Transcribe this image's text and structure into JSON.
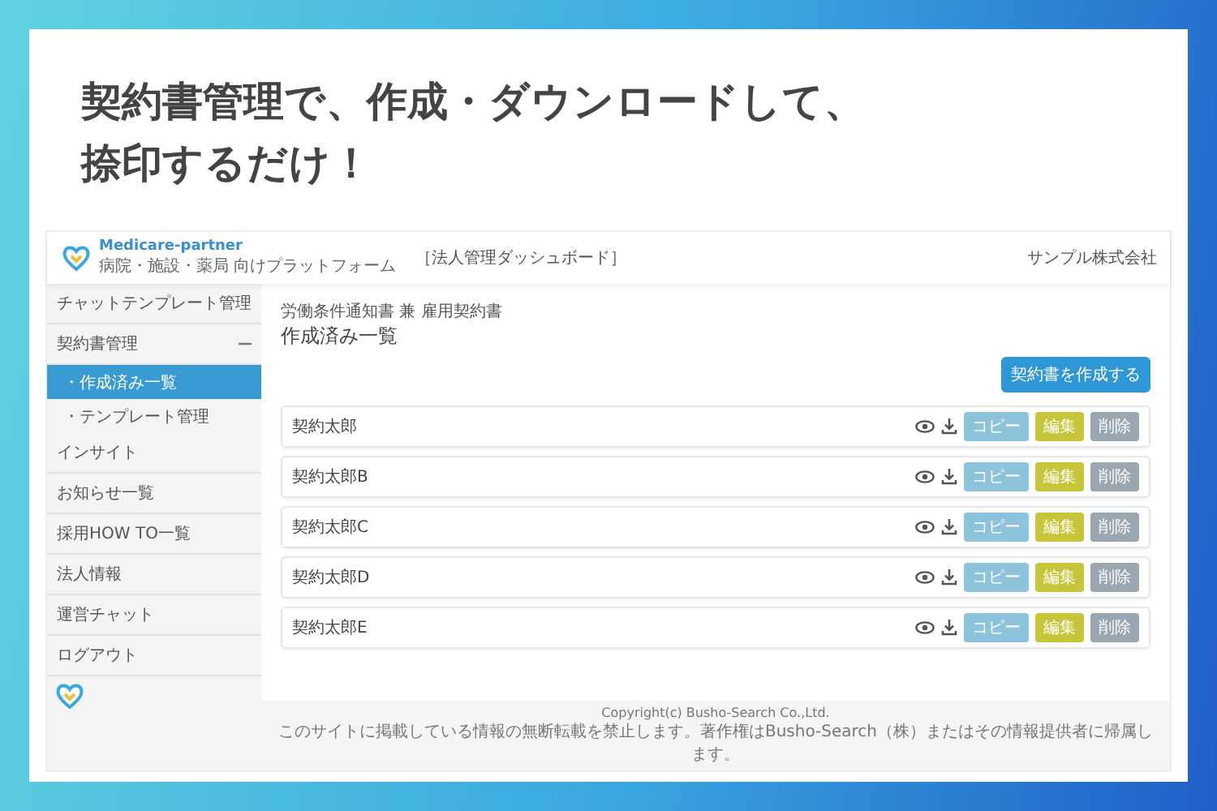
{
  "headline": [
    "契約書管理で、作成・ダウンロードして、",
    "捺印するだけ！"
  ],
  "app": {
    "logo": {
      "name": "Medicare-partner",
      "tagline": "病院・施設・薬局 向けプラットフォーム"
    },
    "dashboard_title": "［法人管理ダッシュボード］",
    "company": "サンプル株式会社",
    "sidebar": [
      {
        "label": "チャットテンプレート管理",
        "selected": false
      },
      {
        "label": "契約書管理",
        "selected": false,
        "expanded": true,
        "children": [
          {
            "label": "・作成済み一覧",
            "selected": true
          },
          {
            "label": "・テンプレート管理",
            "selected": false
          }
        ]
      },
      {
        "label": "インサイト",
        "selected": false
      },
      {
        "label": "お知らせ一覧",
        "selected": false
      },
      {
        "label": "採用HOW TO一覧",
        "selected": false
      },
      {
        "label": "法人情報",
        "selected": false
      },
      {
        "label": "運営チャット",
        "selected": false
      },
      {
        "label": "ログアウト",
        "selected": false
      }
    ],
    "breadcrumb": "労働条件通知書 兼 雇用契約書",
    "page_title": "作成済み一覧",
    "create_button": "契約書を作成する",
    "rows": [
      {
        "name": "契約太郎",
        "copy": "コピー",
        "edit": "編集",
        "delete": "削除"
      },
      {
        "name": "契約太郎B",
        "copy": "コピー",
        "edit": "編集",
        "delete": "削除"
      },
      {
        "name": "契約太郎C",
        "copy": "コピー",
        "edit": "編集",
        "delete": "削除"
      },
      {
        "name": "契約太郎D",
        "copy": "コピー",
        "edit": "編集",
        "delete": "削除"
      },
      {
        "name": "契約太郎E",
        "copy": "コピー",
        "edit": "編集",
        "delete": "削除"
      }
    ],
    "footer": [
      "Copyright(c) Busho-Search Co.,Ltd.",
      "このサイトに掲載している情報の無断転載を禁止します。著作権はBusho-Search（株）またはその情報提供者に帰属します。"
    ]
  }
}
